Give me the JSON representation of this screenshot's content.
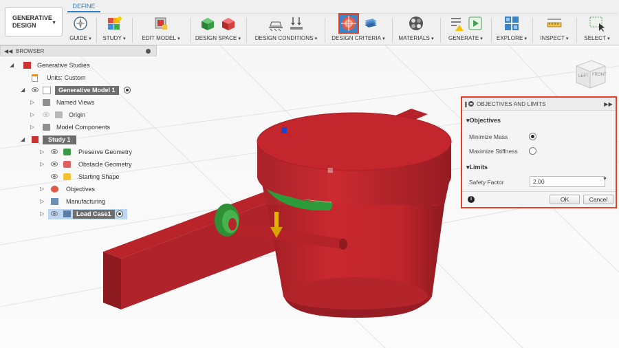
{
  "toolbar": {
    "workspace": {
      "label": "GENERATIVE DESIGN"
    },
    "active_tab": "DEFINE",
    "groups": [
      {
        "label": "GUIDE",
        "icons": [
          "guide-compass-icon"
        ]
      },
      {
        "label": "STUDY",
        "icons": [
          "new-study-icon"
        ]
      },
      {
        "label": "EDIT MODEL",
        "icons": [
          "edit-model-icon"
        ]
      },
      {
        "label": "DESIGN SPACE",
        "icons": [
          "preserve-geometry-icon",
          "obstacle-geometry-icon"
        ]
      },
      {
        "label": "DESIGN CONDITIONS",
        "icons": [
          "structural-constraint-icon",
          "structural-load-icon"
        ]
      },
      {
        "label": "DESIGN CRITERIA",
        "icons": [
          "objectives-icon",
          "manufacturing-icon"
        ]
      },
      {
        "label": "MATERIALS",
        "icons": [
          "study-materials-icon"
        ]
      },
      {
        "label": "GENERATE",
        "icons": [
          "pre-check-icon",
          "generate-icon"
        ]
      },
      {
        "label": "EXPLORE",
        "icons": [
          "explore-icon"
        ]
      },
      {
        "label": "INSPECT",
        "icons": [
          "measure-icon"
        ]
      },
      {
        "label": "SELECT",
        "icons": [
          "select-window-icon"
        ]
      }
    ]
  },
  "browser": {
    "title": "BROWSER",
    "items": [
      {
        "label": "Generative Studies"
      },
      {
        "label": "Units: Custom"
      },
      {
        "label": "Generative Model 1"
      },
      {
        "label": "Named Views"
      },
      {
        "label": "Origin"
      },
      {
        "label": "Model Components"
      },
      {
        "label": "Study 1"
      },
      {
        "label": "Preserve Geometry"
      },
      {
        "label": "Obstacle Geometry"
      },
      {
        "label": "Starting Shape"
      },
      {
        "label": "Objectives"
      },
      {
        "label": "Manufacturing"
      },
      {
        "label": "Load Case1"
      }
    ]
  },
  "viewcube": {
    "left": "LEFT",
    "front": "FRONT"
  },
  "dialog": {
    "title": "OBJECTIVES AND LIMITS",
    "objectives_header": "Objectives",
    "options": [
      {
        "label": "Minimize Mass",
        "selected": true
      },
      {
        "label": "Maximize Stiffness",
        "selected": false
      }
    ],
    "limits_header": "Limits",
    "safety_factor": {
      "label": "Safety Factor",
      "value": "2.00"
    },
    "ok_label": "OK",
    "cancel_label": "Cancel"
  },
  "colors": {
    "highlight": "#e0432a",
    "accent": "#2a7fc7",
    "model_red": "#c0272d",
    "preserve_green": "#2e9b3a",
    "load_arrow": "#d9a400"
  }
}
